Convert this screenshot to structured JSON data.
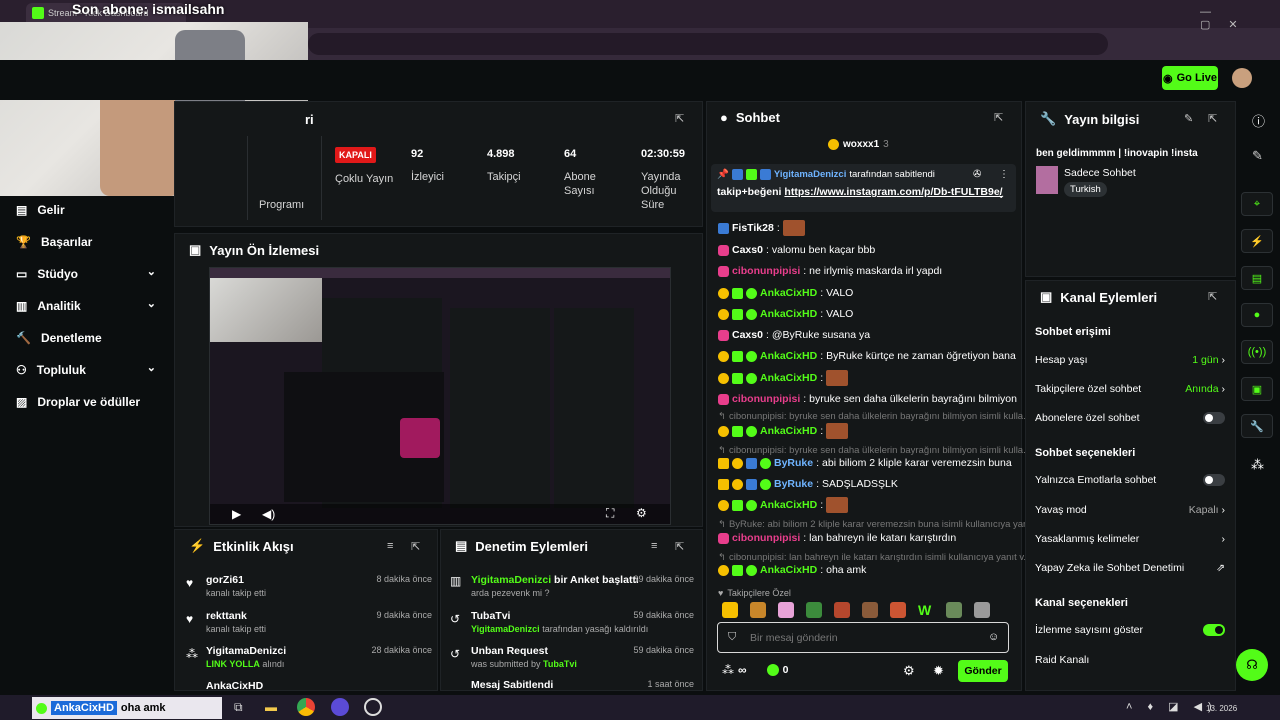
{
  "overlay": {
    "follow_text": "Son abone: ismailsahn"
  },
  "browser": {
    "tab_title": "Stream - Kick Dashboard"
  },
  "topbar": {
    "golive_label": "Go Live"
  },
  "sidebar": {
    "items": [
      {
        "label": "Gelir",
        "icon": "dollar-icon"
      },
      {
        "label": "Başarılar",
        "icon": "trophy-icon"
      },
      {
        "label": "Stüdyo",
        "icon": "studio-icon"
      },
      {
        "label": "Analitik",
        "icon": "chart-icon"
      },
      {
        "label": "Denetleme",
        "icon": "hammer-icon"
      },
      {
        "label": "Topluluk",
        "icon": "community-icon"
      },
      {
        "label": "Droplar ve ödüller",
        "icon": "gift-icon"
      }
    ]
  },
  "stream_stats": {
    "title_partial": "ri",
    "program_label": "Programı",
    "status_badge": "KAPALI",
    "multi_stream": "Çoklu Yayın",
    "stats": [
      {
        "value": "92",
        "label": "İzleyici"
      },
      {
        "value": "4.898",
        "label": "Takipçi"
      },
      {
        "value": "64",
        "label": "Abone Sayısı"
      },
      {
        "value": "02:30:59",
        "label": "Yayında Olduğu Süre"
      }
    ]
  },
  "preview": {
    "title": "Yayın Ön İzlemesi"
  },
  "activity": {
    "title": "Etkinlik Akışı",
    "items": [
      {
        "user": "gorZi61",
        "desc": "kanalı takip etti",
        "time": "8 dakika önce"
      },
      {
        "user": "rekttank",
        "desc": "kanalı takip etti",
        "time": "9 dakika önce"
      },
      {
        "user": "YigitamaDenizci",
        "desc_green": "LINK YOLLA",
        "desc": " alındı",
        "time": "28 dakika önce"
      },
      {
        "user": "AnkaCixHD",
        "desc": "",
        "time": ""
      }
    ]
  },
  "moderation": {
    "title": "Denetim Eylemleri",
    "items": [
      {
        "user": "YigitamaDenizci",
        "action": " bir Anket başlattı",
        "sub": "arda pezevenk mi ?",
        "time": "39 dakika önce"
      },
      {
        "user": "TubaTvi",
        "action": "",
        "sub_user": "YigitamaDenizci",
        "sub": " tarafından yasağı kaldırıldı",
        "time": "59 dakika önce"
      },
      {
        "user": "Unban Request",
        "action": "",
        "sub": "was submitted by ",
        "sub_user": "TubaTvi",
        "time": "59 dakika önce"
      },
      {
        "user": "Mesaj Sabitlendi",
        "action": "",
        "sub": "",
        "time": "1 saat önce"
      }
    ]
  },
  "chat": {
    "title": "Sohbet",
    "top_gifter": "woxxx1",
    "top_gifter_count": "3",
    "pinned_by": "YigitamaDenizci",
    "pinned_suffix": "tarafından sabitlendi",
    "pinned_text": "takip+beğeni",
    "pinned_link": "https://www.instagram.com/p/Db-tFULTB9e/",
    "messages": [
      {
        "user": "FisTik28",
        "text": "",
        "emote": true
      },
      {
        "user": "Caxs0",
        "text": "valomu ben kaçar bbb"
      },
      {
        "user": "cibonunpipisi",
        "text": "ne irlymiş maskarda irl yapdı"
      },
      {
        "user": "AnkaCixHD",
        "text": "VALO"
      },
      {
        "user": "AnkaCixHD",
        "text": "VALO"
      },
      {
        "user": "Caxs0",
        "text": "@ByRuke susana ya"
      },
      {
        "user": "AnkaCixHD",
        "text": "ByRuke kürtçe ne zaman öğretiyon bana"
      },
      {
        "user": "AnkaCixHD",
        "text": "",
        "emote": true
      },
      {
        "user": "cibonunpipisi",
        "text": "byruke sen daha ülkelerin bayrağını bilmiyon"
      },
      {
        "reply": "cibonunpipisi: byruke sen daha ülkelerin bayrağını bilmiyon isimli kulla..."
      },
      {
        "user": "AnkaCixHD",
        "text": "",
        "emote": true
      },
      {
        "reply": "cibonunpipisi: byruke sen daha ülkelerin bayrağını bilmiyon isimli kulla..."
      },
      {
        "user": "ByRuke",
        "text": "abi biliom 2 kliple karar veremezsin buna"
      },
      {
        "user": "ByRuke",
        "text": "SADŞLADSŞLK"
      },
      {
        "user": "AnkaCixHD",
        "text": "",
        "emote": true
      },
      {
        "reply": "ByRuke: abi biliom 2 kliple karar veremezsin buna isimli kullanıcıya yan..."
      },
      {
        "user": "cibonunpipisi",
        "text": "lan bahreyn ile katarı karıştırdın"
      },
      {
        "reply": "cibonunpipisi: lan bahreyn ile katarı karıştırdın isimli kullanıcıya yanıt v..."
      },
      {
        "user": "AnkaCixHD",
        "text": "oha amk"
      }
    ],
    "followers_only": "Takipçilere Özel",
    "input_placeholder": "Bir mesaj gönderin",
    "infinity": "∞",
    "kick_count": "0",
    "send_label": "Gönder"
  },
  "stream_info": {
    "title": "Yayın bilgisi",
    "stream_title": "ben geldimmmm | !inovapin !insta",
    "category": "Sadece Sohbet",
    "language": "Turkish"
  },
  "channel_actions": {
    "title": "Kanal Eylemleri",
    "chat_access_title": "Sohbet erişimi",
    "account_age": {
      "label": "Hesap yaşı",
      "value": "1 gün"
    },
    "followers_chat": {
      "label": "Takipçilere özel sohbet",
      "value": "Anında"
    },
    "subs_chat": {
      "label": "Abonelere özel sohbet"
    },
    "chat_options_title": "Sohbet seçenekleri",
    "emote_only": {
      "label": "Yalnızca Emotlarla sohbet"
    },
    "slow_mode": {
      "label": "Yavaş mod",
      "value": "Kapalı"
    },
    "banned_words": {
      "label": "Yasaklanmış kelimeler"
    },
    "ai_moderation": {
      "label": "Yapay Zeka ile Sohbet Denetimi"
    },
    "channel_options_title": "Kanal seçenekleri",
    "show_viewers": {
      "label": "İzlenme sayısını göster"
    },
    "raid": {
      "label": "Raid Kanalı"
    }
  },
  "taskbar": {
    "toast_user": "AnkaCixHD",
    "toast_text": "oha amk",
    "date": "13.  2026"
  },
  "colors": {
    "accent": "#53fc18",
    "bg": "#0b0e0f",
    "panel": "#141718",
    "danger": "#e11919"
  }
}
